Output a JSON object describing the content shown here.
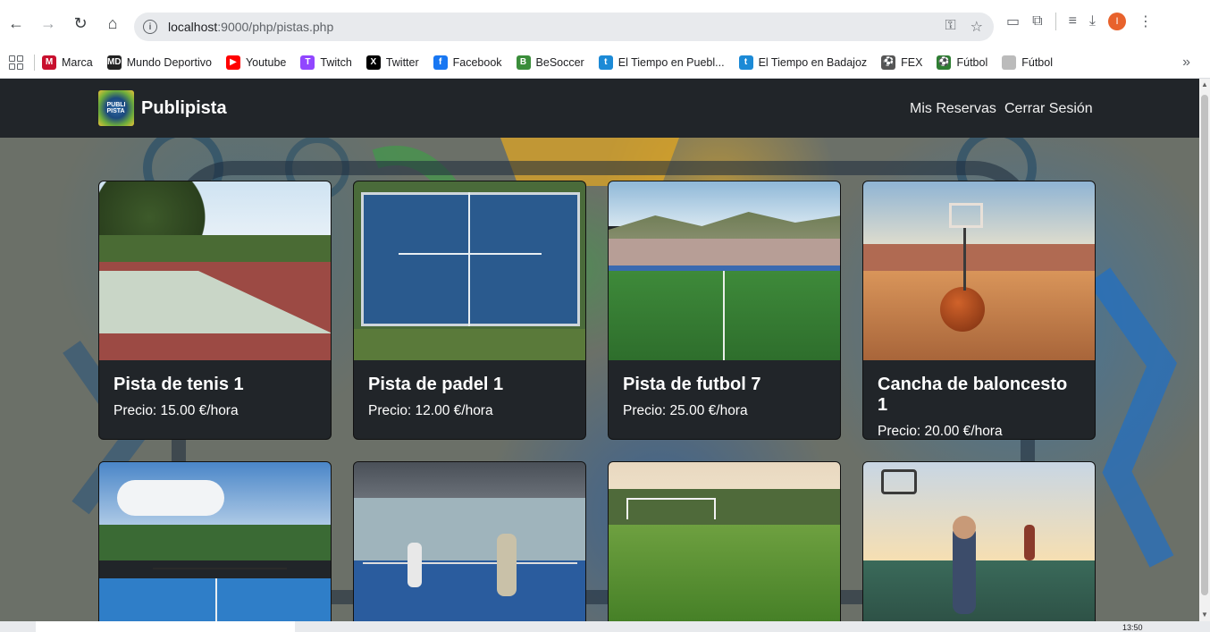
{
  "browser": {
    "url_host": "localhost",
    "url_path": ":9000/php/pistas.php",
    "profile_initial": "I"
  },
  "bookmarks": [
    {
      "label": "Marca",
      "icon": "marca-icon",
      "color": "#c8102e",
      "glyph": "M"
    },
    {
      "label": "Mundo Deportivo",
      "icon": "mundo-deportivo-icon",
      "color": "#222222",
      "glyph": "MD"
    },
    {
      "label": "Youtube",
      "icon": "youtube-icon",
      "color": "#ff0000",
      "glyph": "▶"
    },
    {
      "label": "Twitch",
      "icon": "twitch-icon",
      "color": "#9146ff",
      "glyph": "T"
    },
    {
      "label": "Twitter",
      "icon": "x-icon",
      "color": "#000000",
      "glyph": "X"
    },
    {
      "label": "Facebook",
      "icon": "facebook-icon",
      "color": "#1877f2",
      "glyph": "f"
    },
    {
      "label": "BeSoccer",
      "icon": "besoccer-icon",
      "color": "#3a8d3a",
      "glyph": "B"
    },
    {
      "label": "El Tiempo en Puebl...",
      "icon": "eltiempo-icon",
      "color": "#1c8ad6",
      "glyph": "t"
    },
    {
      "label": "El Tiempo en Badajoz",
      "icon": "eltiempo-icon",
      "color": "#1c8ad6",
      "glyph": "t"
    },
    {
      "label": "FEX",
      "icon": "football-icon",
      "color": "#555555",
      "glyph": "⚽"
    },
    {
      "label": "Fútbol",
      "icon": "football-icon",
      "color": "#2e7d32",
      "glyph": "⚽"
    },
    {
      "label": "Fútbol",
      "icon": "page-icon",
      "color": "#bbbbbb",
      "glyph": ""
    }
  ],
  "site": {
    "brand": "Publipista",
    "nav": {
      "reservas": "Mis Reservas",
      "logout": "Cerrar Sesión"
    }
  },
  "pistas": [
    {
      "title": "Pista de tenis 1",
      "price": "Precio: 15.00 €/hora"
    },
    {
      "title": "Pista de padel 1",
      "price": "Precio: 12.00 €/hora"
    },
    {
      "title": "Pista de futbol 7",
      "price": "Precio: 25.00 €/hora"
    },
    {
      "title": "Cancha de baloncesto 1",
      "price": "Precio: 20.00 €/hora"
    }
  ],
  "taskbar": {
    "clock": "13:50"
  }
}
